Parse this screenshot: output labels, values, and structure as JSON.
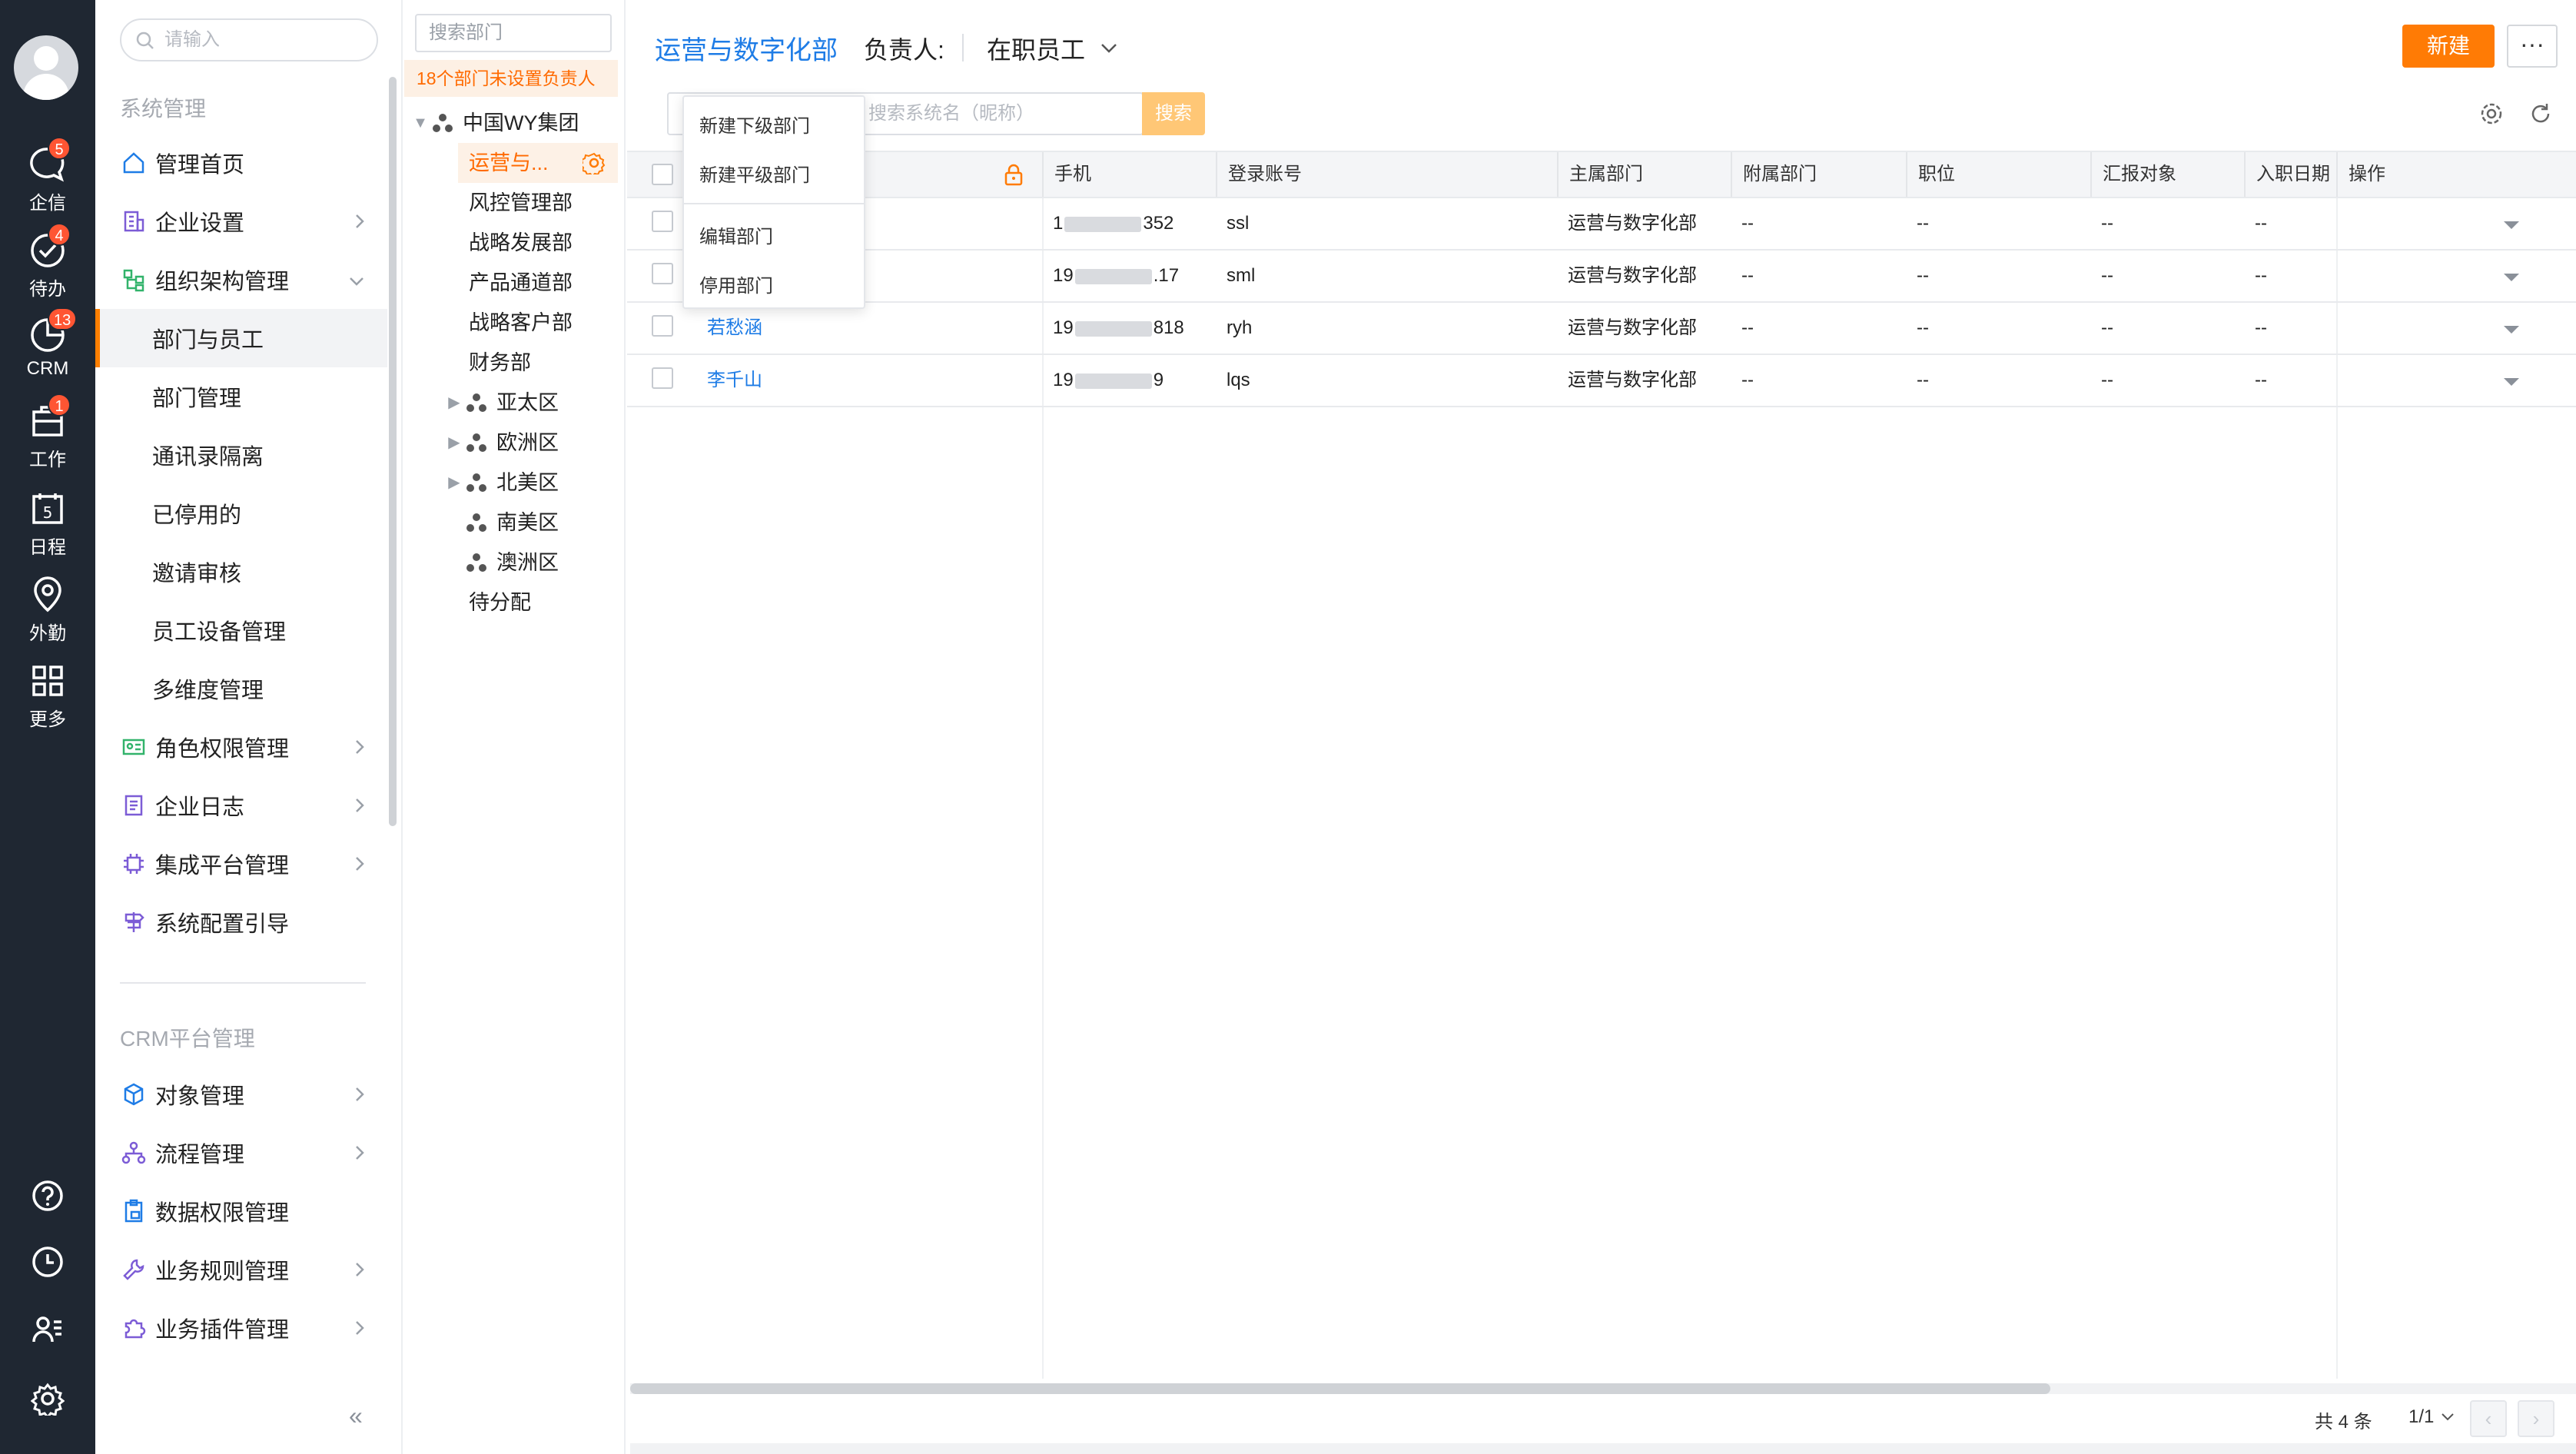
{
  "rail": {
    "items": [
      {
        "label": "企信",
        "badge": "5"
      },
      {
        "label": "待办",
        "badge": "4"
      },
      {
        "label": "CRM",
        "badge": "13"
      },
      {
        "label": "工作",
        "badge": "1"
      },
      {
        "label": "日程",
        "badge": ""
      },
      {
        "label": "外勤",
        "badge": ""
      },
      {
        "label": "更多",
        "badge": ""
      }
    ],
    "calendar_day": "5"
  },
  "menu": {
    "search_placeholder": "请输入",
    "section_system": "系统管理",
    "section_crm": "CRM平台管理",
    "items": [
      {
        "label": "管理首页"
      },
      {
        "label": "企业设置"
      },
      {
        "label": "组织架构管理"
      },
      {
        "label": "部门与员工"
      },
      {
        "label": "部门管理"
      },
      {
        "label": "通讯录隔离"
      },
      {
        "label": "已停用的"
      },
      {
        "label": "邀请审核"
      },
      {
        "label": "员工设备管理"
      },
      {
        "label": "多维度管理"
      },
      {
        "label": "角色权限管理"
      },
      {
        "label": "企业日志"
      },
      {
        "label": "集成平台管理"
      },
      {
        "label": "系统配置引导"
      }
    ],
    "crm_items": [
      {
        "label": "对象管理"
      },
      {
        "label": "流程管理"
      },
      {
        "label": "数据权限管理"
      },
      {
        "label": "业务规则管理"
      },
      {
        "label": "业务插件管理"
      }
    ],
    "collapse": "«"
  },
  "tree": {
    "search_placeholder": "搜索部门",
    "warning": "18个部门未设置负责人",
    "root": "中国WY集团",
    "selected": "运营与...",
    "children": [
      "风控管理部",
      "战略发展部",
      "产品通道部",
      "战略客户部",
      "财务部"
    ],
    "regions": [
      "亚太区",
      "欧洲区",
      "北美区",
      "南美区",
      "澳洲区"
    ],
    "unassigned": "待分配"
  },
  "header": {
    "title": "运营与数字化部",
    "owner_label": "负责人:",
    "status_filter": "在职员工",
    "new_button": "新建",
    "more_button": "···"
  },
  "filter": {
    "placeholder": "搜索系统名（昵称）",
    "search_button": "搜索"
  },
  "context_menu": {
    "items": [
      "新建下级部门",
      "新建平级部门",
      "编辑部门",
      "停用部门"
    ]
  },
  "table": {
    "columns": [
      "手机",
      "登录账号",
      "主属部门",
      "附属部门",
      "职位",
      "汇报对象",
      "入职日期",
      "操作"
    ],
    "rows": [
      {
        "name": "",
        "phone_start": "1",
        "phone_end": "352",
        "account": "ssl",
        "dept": "运营与数字化部",
        "sub_dept": "--",
        "position": "--",
        "report_to": "--",
        "join_date": "--"
      },
      {
        "name": "",
        "phone_start": "19",
        "phone_end": ".17",
        "account": "sml",
        "dept": "运营与数字化部",
        "sub_dept": "--",
        "position": "--",
        "report_to": "--",
        "join_date": "--"
      },
      {
        "name": "若愁涵",
        "phone_start": "19",
        "phone_end": "818",
        "account": "ryh",
        "dept": "运营与数字化部",
        "sub_dept": "--",
        "position": "--",
        "report_to": "--",
        "join_date": "--"
      },
      {
        "name": "李千山",
        "phone_start": "19",
        "phone_end": "9",
        "account": "lqs",
        "dept": "运营与数字化部",
        "sub_dept": "--",
        "position": "--",
        "report_to": "--",
        "join_date": "--"
      }
    ]
  },
  "pagination": {
    "total": "共 4 条",
    "page": "1/1",
    "prev": "‹",
    "next": "›"
  },
  "colors": {
    "accent": "#ff7b05",
    "link": "#1e7ce6",
    "rail_bg": "#1f2732",
    "badge": "#ff5533"
  }
}
